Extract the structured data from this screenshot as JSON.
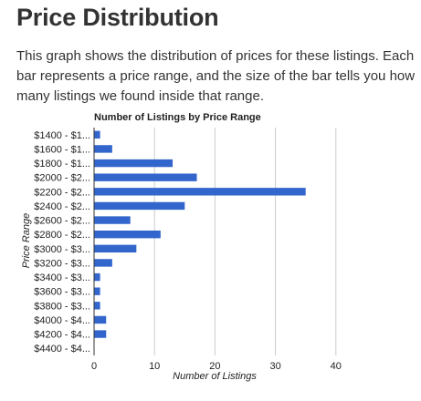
{
  "page": {
    "heading": "Price Distribution",
    "description": "This graph shows the distribution of prices for these listings. Each bar represents a price range, and the size of the bar tells you how many listings we found inside that range."
  },
  "chart_data": {
    "type": "bar",
    "orientation": "horizontal",
    "title": "Number of Listings by Price Range",
    "xlabel": "Number of Listings",
    "ylabel": "Price Range",
    "categories": [
      "$1400 - $1...",
      "$1600 - $1...",
      "$1800 - $1...",
      "$2000 - $2...",
      "$2200 - $2...",
      "$2400 - $2...",
      "$2600 - $2...",
      "$2800 - $2...",
      "$3000 - $3...",
      "$3200 - $3...",
      "$3400 - $3...",
      "$3600 - $3...",
      "$3800 - $3...",
      "$4000 - $4...",
      "$4200 - $4...",
      "$4400 - $4..."
    ],
    "values": [
      1,
      3,
      13,
      17,
      35,
      15,
      6,
      11,
      7,
      3,
      1,
      1,
      1,
      2,
      2,
      0
    ],
    "xlim": [
      0,
      45
    ],
    "xticks": [
      0,
      10,
      20,
      30,
      40
    ],
    "grid": true,
    "legend": "none",
    "colors": {
      "bar": "#3366cc",
      "grid": "#cccccc",
      "axis": "#333333",
      "text": "#222222",
      "axis_title": "#222222"
    }
  }
}
